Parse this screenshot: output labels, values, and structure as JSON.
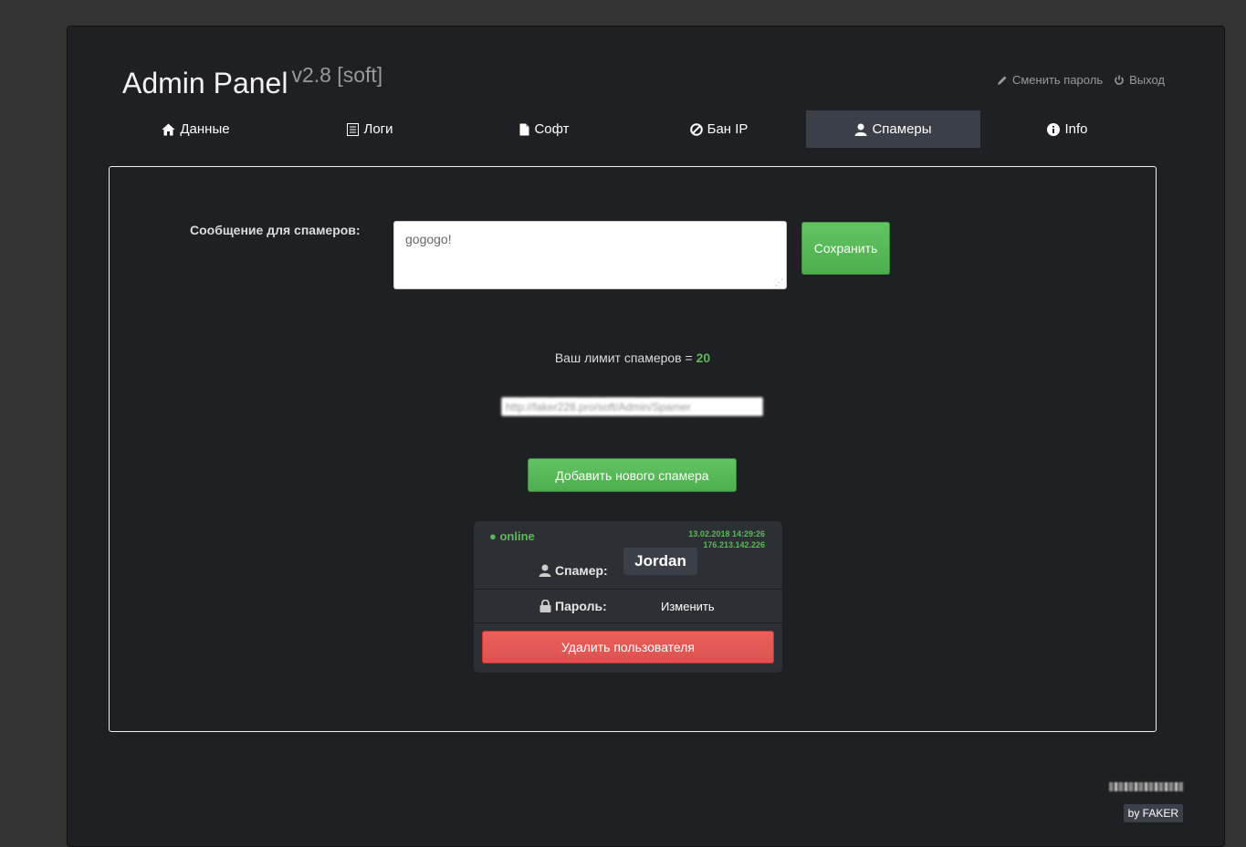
{
  "header": {
    "title": "Admin Panel",
    "version": "v2.8 [soft]",
    "change_password": "Сменить пароль",
    "logout": "Выход"
  },
  "tabs": [
    {
      "label": "Данные",
      "icon": "home-icon"
    },
    {
      "label": "Логи",
      "icon": "list-icon"
    },
    {
      "label": "Софт",
      "icon": "file-icon"
    },
    {
      "label": "Бан IP",
      "icon": "ban-icon"
    },
    {
      "label": "Спамеры",
      "icon": "user-icon",
      "active": true
    },
    {
      "label": "Info",
      "icon": "info-icon"
    }
  ],
  "spam_message": {
    "label": "Сообщение для спамеров:",
    "value": "gogogo!",
    "save_label": "Сохранить"
  },
  "limit": {
    "prefix": "Ваш лимит спамеров = ",
    "value": "20"
  },
  "spammer_link": "http://faker228.pro/soft/Admin/Spamer",
  "add_spammer_label": "Добавить нового спамера",
  "spammer_card": {
    "status": "● online",
    "datetime": "13.02.2018 14:29:26",
    "ip": "176.213.142.226",
    "spammer_label": "Спамер:",
    "name": "Jordan",
    "password_label": "Пароль:",
    "change_label": "Изменить",
    "delete_label": "Удалить пользователя"
  },
  "footer": {
    "by": "by FAKER"
  },
  "colors": {
    "accent_green": "#5cb85c",
    "danger_red": "#d9534f",
    "active_tab": "#3b3f47"
  }
}
